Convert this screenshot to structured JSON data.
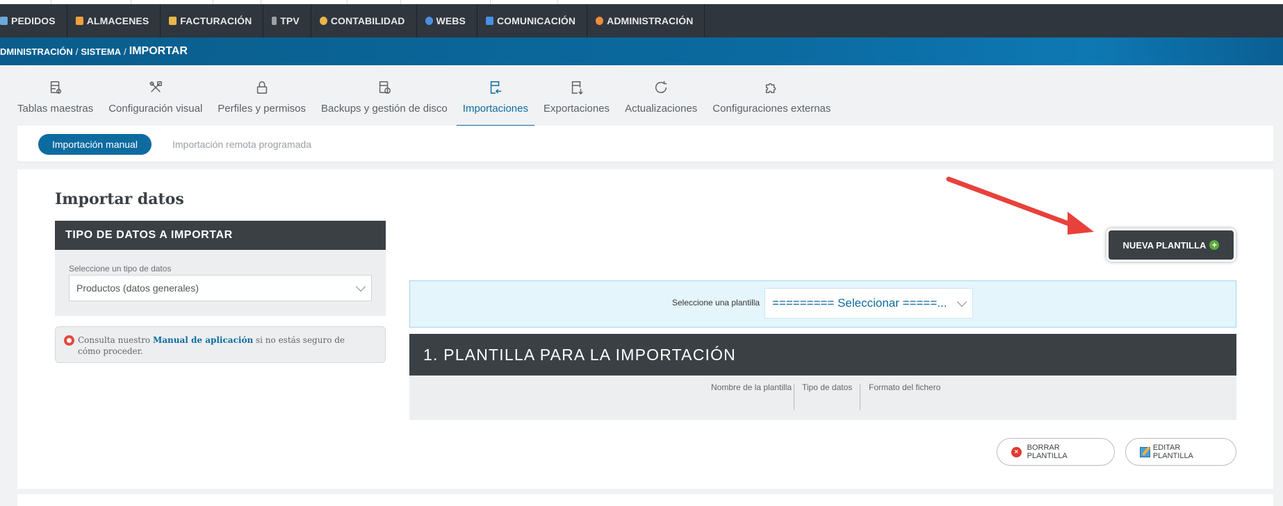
{
  "nav": {
    "items": [
      {
        "label": "PEDIDOS",
        "icon": "document-icon",
        "color": "#6ea8dc"
      },
      {
        "label": "ALMACENES",
        "icon": "warehouse-icon",
        "color": "#f0a03c"
      },
      {
        "label": "FACTURACIÓN",
        "icon": "invoice-icon",
        "color": "#e8b64a"
      },
      {
        "label": "TPV",
        "icon": "pos-terminal-icon",
        "color": "#9aa0a6"
      },
      {
        "label": "CONTABILIDAD",
        "icon": "coins-icon",
        "color": "#e8b64a"
      },
      {
        "label": "WEBS",
        "icon": "globe-icon",
        "color": "#4a90e2"
      },
      {
        "label": "COMUNICACIÓN",
        "icon": "chat-icon",
        "color": "#4a90e2"
      },
      {
        "label": "ADMINISTRACIÓN",
        "icon": "gears-icon",
        "color": "#f08c3c"
      }
    ]
  },
  "breadcrumb": {
    "part1": "DMINISTRACIÓN",
    "part2": "SISTEMA",
    "current": "IMPORTAR",
    "sep": "/"
  },
  "tabs": [
    {
      "label": "Tablas maestras",
      "icon": "table-gear-icon"
    },
    {
      "label": "Configuración visual",
      "icon": "tools-icon"
    },
    {
      "label": "Perfiles y permisos",
      "icon": "lock-icon"
    },
    {
      "label": "Backups y gestión de disco",
      "icon": "backup-icon"
    },
    {
      "label": "Importaciones",
      "icon": "import-icon",
      "active": true
    },
    {
      "label": "Exportaciones",
      "icon": "export-icon"
    },
    {
      "label": "Actualizaciones",
      "icon": "refresh-icon"
    },
    {
      "label": "Configuraciones externas",
      "icon": "puzzle-icon"
    }
  ],
  "subtabs": {
    "active": "Importación manual",
    "other": "Importación remota programada"
  },
  "main": {
    "title": "Importar datos",
    "data_type_header": "TIPO DE DATOS A IMPORTAR",
    "data_type_label": "Seleccione un tipo de datos",
    "data_type_value": "Productos (datos generales)",
    "help_prefix": "Consulta nuestro",
    "help_link": "Manual de aplicación",
    "help_suffix": "si no estás seguro de cómo proceder.",
    "new_template_button": "NUEVA PLANTILLA",
    "select_template_label": "Seleccione una plantilla",
    "select_template_value": "========= Seleccionar =====...",
    "template_section_title": "1. PLANTILLA PARA LA IMPORTACIÓN",
    "columns": [
      "Nombre de la plantilla",
      "Tipo de datos",
      "Formato del fichero"
    ],
    "delete_button": "BORRAR PLANTILLA",
    "edit_button": "EDITAR PLANTILLA"
  },
  "colors": {
    "nav_bg": "#2f363d",
    "breadcrumb_bg": "#0b6aa0",
    "accent": "#0e6ba0",
    "dark_header": "#3b4045",
    "annotation_arrow": "#e8413c"
  }
}
